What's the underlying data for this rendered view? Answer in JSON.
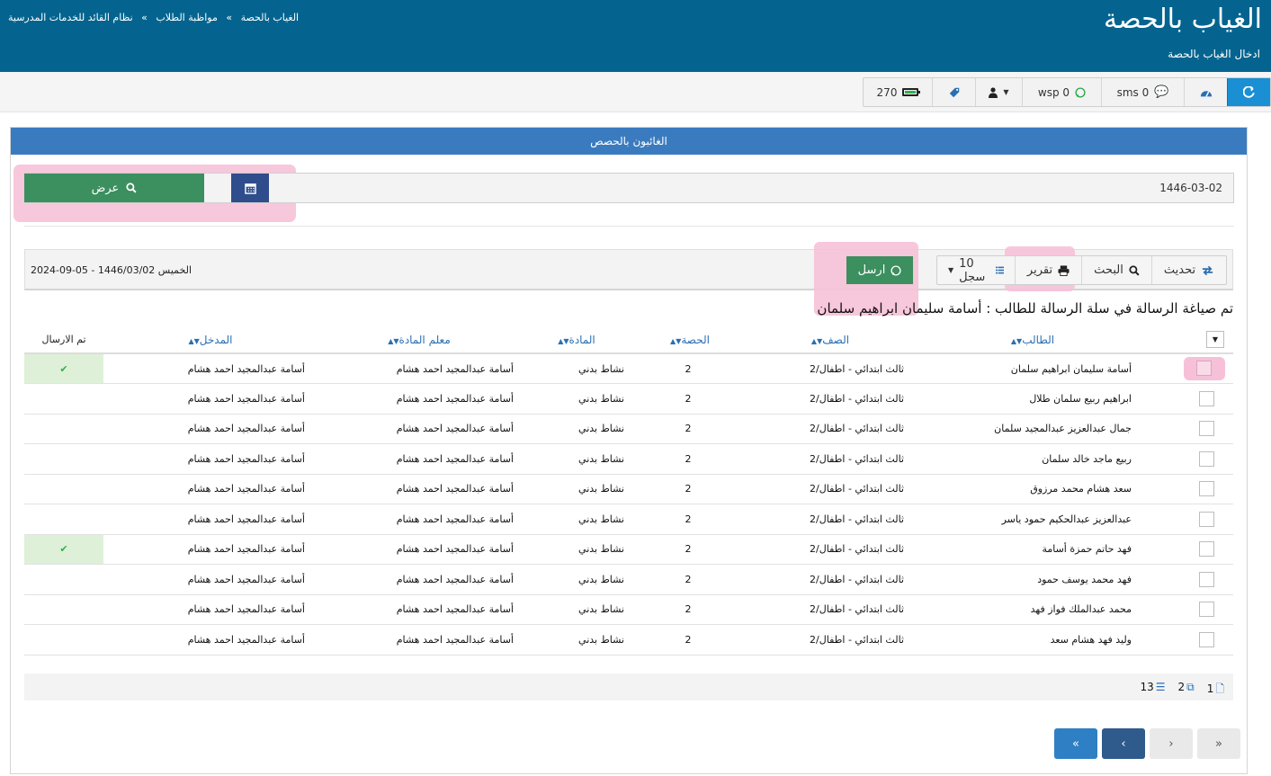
{
  "header": {
    "title": "الغياب بالحصة",
    "subtitle": "ادخال الغياب بالحصة",
    "breadcrumb": [
      "نظام القائد للخدمات المدرسية",
      "مواظبة الطلاب",
      "الغياب بالحصة"
    ],
    "breadcrumb_sep": "»"
  },
  "toolbar": {
    "sms_label": "sms 0",
    "wsp_label": "wsp 0",
    "battery_value": "270"
  },
  "panel": {
    "title": "الغائبون بالحصص",
    "date_value": "1446-03-02",
    "show_button": "عرض"
  },
  "grid_toolbar": {
    "refresh_label": "تحديث",
    "search_label": "البحث",
    "report_label": "تقرير",
    "records_label": "10 سجل",
    "send_label": "ارسل",
    "date_text": "2024-09-05 - 1446/03/02 الخميس"
  },
  "message": "تم صياغة الرسالة في سلة الرسالة للطالب : أسامة سليمان ابراهيم سلمان",
  "table": {
    "headers": {
      "student": "الطالب",
      "class": "الصف",
      "period": "الحصة",
      "subject": "المادة",
      "teacher": "معلم المادة",
      "entered_by": "المدخل",
      "sent": "تم الارسال"
    },
    "rows": [
      {
        "student": "أسامة سليمان ابراهيم سلمان",
        "class": "ثالث ابتدائي - اطفال/2",
        "period": "2",
        "subject": "نشاط بدني",
        "teacher": "أسامة عبدالمجيد احمد هشام",
        "entered_by": "أسامة عبدالمجيد احمد هشام",
        "sent": true
      },
      {
        "student": "ابراهيم ربيع سلمان طلال",
        "class": "ثالث ابتدائي - اطفال/2",
        "period": "2",
        "subject": "نشاط بدني",
        "teacher": "أسامة عبدالمجيد احمد هشام",
        "entered_by": "أسامة عبدالمجيد احمد هشام",
        "sent": false
      },
      {
        "student": "جمال عبدالعزيز عبدالمجيد سلمان",
        "class": "ثالث ابتدائي - اطفال/2",
        "period": "2",
        "subject": "نشاط بدني",
        "teacher": "أسامة عبدالمجيد احمد هشام",
        "entered_by": "أسامة عبدالمجيد احمد هشام",
        "sent": false
      },
      {
        "student": "ربيع ماجد خالد سلمان",
        "class": "ثالث ابتدائي - اطفال/2",
        "period": "2",
        "subject": "نشاط بدني",
        "teacher": "أسامة عبدالمجيد احمد هشام",
        "entered_by": "أسامة عبدالمجيد احمد هشام",
        "sent": false
      },
      {
        "student": "سعد هشام محمد مرزوق",
        "class": "ثالث ابتدائي - اطفال/2",
        "period": "2",
        "subject": "نشاط بدني",
        "teacher": "أسامة عبدالمجيد احمد هشام",
        "entered_by": "أسامة عبدالمجيد احمد هشام",
        "sent": false
      },
      {
        "student": "عبدالعزيز عبدالحكيم حمود ياسر",
        "class": "ثالث ابتدائي - اطفال/2",
        "period": "2",
        "subject": "نشاط بدني",
        "teacher": "أسامة عبدالمجيد احمد هشام",
        "entered_by": "أسامة عبدالمجيد احمد هشام",
        "sent": false
      },
      {
        "student": "فهد حاتم حمزة أسامة",
        "class": "ثالث ابتدائي - اطفال/2",
        "period": "2",
        "subject": "نشاط بدني",
        "teacher": "أسامة عبدالمجيد احمد هشام",
        "entered_by": "أسامة عبدالمجيد احمد هشام",
        "sent": true
      },
      {
        "student": "فهد محمد يوسف حمود",
        "class": "ثالث ابتدائي - اطفال/2",
        "period": "2",
        "subject": "نشاط بدني",
        "teacher": "أسامة عبدالمجيد احمد هشام",
        "entered_by": "أسامة عبدالمجيد احمد هشام",
        "sent": false
      },
      {
        "student": "محمد عبدالملك فواز فهد",
        "class": "ثالث ابتدائي - اطفال/2",
        "period": "2",
        "subject": "نشاط بدني",
        "teacher": "أسامة عبدالمجيد احمد هشام",
        "entered_by": "أسامة عبدالمجيد احمد هشام",
        "sent": false
      },
      {
        "student": "وليد فهد هشام سعد",
        "class": "ثالث ابتدائي - اطفال/2",
        "period": "2",
        "subject": "نشاط بدني",
        "teacher": "أسامة عبدالمجيد احمد هشام",
        "entered_by": "أسامة عبدالمجيد احمد هشام",
        "sent": false
      }
    ]
  },
  "footer": {
    "page_count": "1",
    "copies_count": "2",
    "list_count": "13"
  },
  "pagination": {
    "first": "«",
    "prev": "‹",
    "next": "›",
    "last": "»"
  },
  "colors": {
    "header_bg": "#04648f",
    "panel_head": "#3a7bbf",
    "primary_green": "#3c8f5e",
    "highlight_pink": "#f6c1d8",
    "sent_ok": "#dff0d8"
  }
}
